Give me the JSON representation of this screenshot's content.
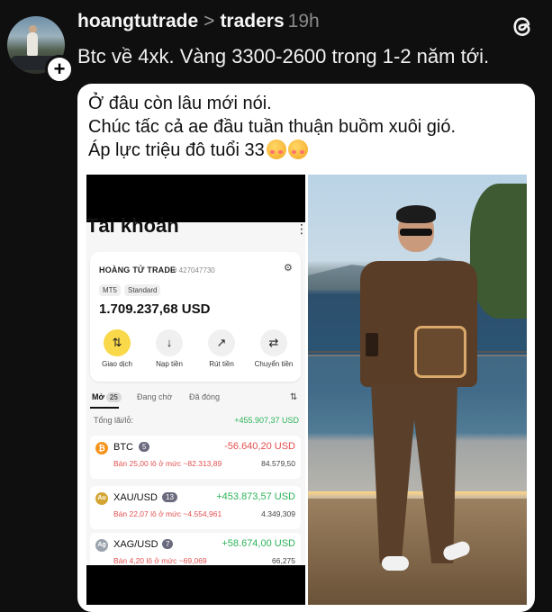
{
  "post": {
    "username": "hoangtutrade",
    "separator": ">",
    "topic": "traders",
    "time": "19h",
    "text": "Btc về 4xk. Vàng 3300-2600 trong 1-2 năm tới."
  },
  "quote": {
    "line1": "Ở đâu còn lâu mới nói.",
    "line2": "Chúc tấc cả ae đầu tuần thuận buồm xuôi gió.",
    "line3": "Áp lực triệu đô tuổi 33"
  },
  "account": {
    "title": "Tài khoản",
    "name": "HOÀNG TỬ TRADE",
    "id": "# 427047730",
    "chip1": "MT5",
    "chip2": "Standard",
    "balance": "1.709.237,68 USD",
    "actions": [
      {
        "label": "Giao dịch",
        "icon": "⇅"
      },
      {
        "label": "Nạp tiền",
        "icon": "↓"
      },
      {
        "label": "Rút tiền",
        "icon": "↗"
      },
      {
        "label": "Chuyển tiền",
        "icon": "⇄"
      }
    ]
  },
  "tabs": {
    "open": "Mở",
    "open_count": "25",
    "pending": "Đang chờ",
    "closed": "Đã đóng"
  },
  "total": {
    "label": "Tổng lãi/lỗ:",
    "value": "+455.907,37 USD"
  },
  "positions": [
    {
      "symbol": "BTC",
      "count": "5",
      "pnl": "-56.640,20 USD",
      "pnl_color": "#e35050",
      "detail": "Bán 25,00 lô ở mức ~82.313,89",
      "price": "84.579,50",
      "coin_color": "#f7931a",
      "coin": "₿"
    },
    {
      "symbol": "XAU/USD",
      "count": "13",
      "pnl": "+453.873,57 USD",
      "pnl_color": "#2db35a",
      "detail": "Bán 22,07 lô ở mức ~4.554,961",
      "price": "4.349,309",
      "coin_color": "#d4a534",
      "coin": "Au"
    },
    {
      "symbol": "XAG/USD",
      "count": "7",
      "pnl": "+58.674,00 USD",
      "pnl_color": "#2db35a",
      "detail": "Bán 4,20 lô ở mức ~69,069",
      "price": "66,275",
      "coin_color": "#9aa3ad",
      "coin": "Ag"
    }
  ],
  "colors": {
    "background": "#0f0f0f",
    "profit": "#2db35a",
    "loss": "#e35050",
    "accent": "#f9d84a"
  }
}
